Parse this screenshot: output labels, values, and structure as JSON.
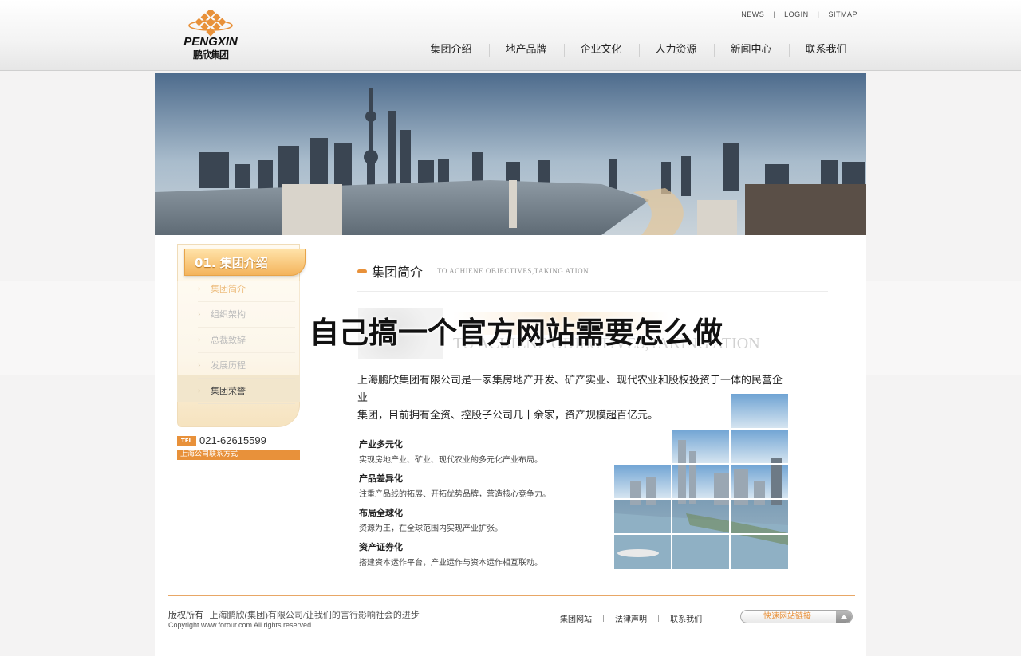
{
  "header": {
    "logo_en": "PENGXIN",
    "logo_cn": "鹏欣集团",
    "top_links": [
      "NEWS",
      "LOGIN",
      "SITMAP"
    ],
    "separator": "|",
    "nav": [
      "集团介绍",
      "地产品牌",
      "企业文化",
      "人力资源",
      "新闻中心",
      "联系我们"
    ]
  },
  "sidebar": {
    "tab_title": "01. 集团介绍",
    "arrow": "›",
    "items": [
      "集团简介",
      "组织架构",
      "总裁致辞",
      "发展历程",
      "集团荣誉"
    ],
    "tel_tag": "TEL",
    "tel": "021-62615599",
    "contact": "上海公司联系方式"
  },
  "main": {
    "section_title": "集团简介",
    "section_en": "TO ACHIENE OBJECTIVES,TAKING ATION",
    "hero_en": "TO ACHIENE OBJECTIVES,TAKING ATION",
    "overlay_title": "自己搞一个官方网站需要怎么做",
    "intro_1": "上海鹏欣集团有限公司是一家集房地产开发、矿产实业、现代农业和股权投资于一体的民营企业",
    "intro_2": "集团，目前拥有全资、控股子公司几十余家，资产规模超百亿元。",
    "features": [
      {
        "title": "产业多元化",
        "desc": "实现房地产业、矿业、现代农业的多元化产业布局。"
      },
      {
        "title": "产品差异化",
        "desc": "注重产品线的拓展、开拓优势品牌，营造核心竞争力。"
      },
      {
        "title": "布局全球化",
        "desc": "资源为王，在全球范围内实现产业扩张。"
      },
      {
        "title": "资产证券化",
        "desc": "搭建资本运作平台，产业运作与资本运作相互联动。"
      }
    ]
  },
  "footer": {
    "rights": "版权所有",
    "company": "上海鹏欣(集团)有限公司/让我们的言行影响社会的进步",
    "copyright": "Copyright www.forour.com All rights reserved.",
    "links": [
      "集团网站",
      "法律声明",
      "联系我们"
    ],
    "separator": "|",
    "quick_link": "快速网站链接"
  },
  "colors": {
    "accent": "#e8913a",
    "tab_gradient_top": "#ffe2a8",
    "tab_gradient_bottom": "#f4b45c"
  }
}
